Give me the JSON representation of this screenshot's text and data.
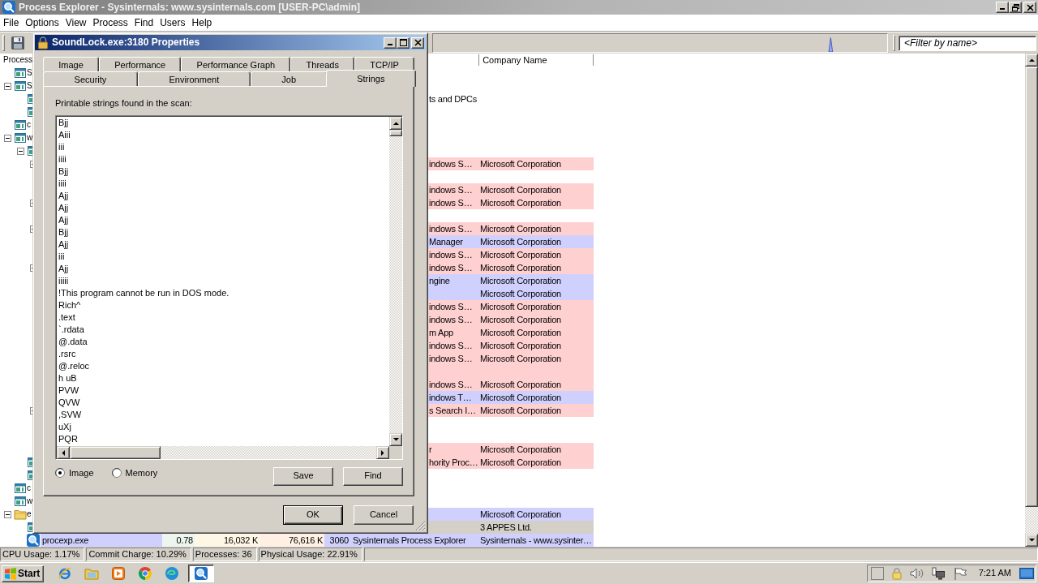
{
  "window": {
    "title": "Process Explorer - Sysinternals: www.sysinternals.com [USER-PC\\admin]"
  },
  "menu": [
    "File",
    "Options",
    "View",
    "Process",
    "Find",
    "Users",
    "Help"
  ],
  "toolbar": {
    "filter": {
      "placeholder": "<Filter by name>"
    }
  },
  "process_list": {
    "columns": [
      "Process",
      "Company Name"
    ],
    "tree": [
      {
        "kind": "window",
        "label": "S",
        "selected": false
      },
      {
        "kind": "window",
        "label": "S",
        "expanded": true,
        "selected": false,
        "children": [
          {
            "kind": "window",
            "description": "ts and DPCs",
            "selected": false
          },
          {
            "kind": "window",
            "selected": false
          }
        ]
      },
      {
        "kind": "window",
        "label": "c",
        "selected": false
      },
      {
        "kind": "window",
        "label": "w",
        "expanded": true,
        "selected": false,
        "children": [
          {
            "kind": "window",
            "expanded": true,
            "selected": false,
            "children": [
              {
                "description": "indows S…",
                "company": "Microsoft Corporation",
                "color": "#ffd0d0",
                "selected": false,
                "children": [
                  {
                    "selected": false
                  },
                  {
                    "description": "indows S…",
                    "company": "Microsoft Corporation",
                    "color": "#ffd0d0",
                    "selected": false
                  }
                ]
              },
              {
                "description": "indows S…",
                "company": "Microsoft Corporation",
                "color": "#ffd0d0",
                "selected": false,
                "children": [
                  {
                    "selected": false
                  }
                ]
              },
              {
                "description": "indows S…",
                "company": "Microsoft Corporation",
                "color": "#ffd0d0",
                "selected": false,
                "children": [
                  {
                    "description": "Manager",
                    "company": "Microsoft Corporation",
                    "color": "#d0d0ff",
                    "selected": false
                  },
                  {
                    "description": "indows S…",
                    "company": "Microsoft Corporation",
                    "color": "#ffd0d0",
                    "selected": false
                  }
                ]
              },
              {
                "description": "indows S…",
                "company": "Microsoft Corporation",
                "color": "#ffd0d0",
                "selected": false,
                "children": [
                  {
                    "description": "ngine",
                    "company": "Microsoft Corporation",
                    "color": "#d0d0ff",
                    "selected": false
                  },
                  {
                    "company": "Microsoft Corporation",
                    "color": "#d0d0ff",
                    "selected": false
                  },
                  {
                    "description": "indows S…",
                    "company": "Microsoft Corporation",
                    "color": "#ffd0d0",
                    "selected": false
                  },
                  {
                    "description": "indows S…",
                    "company": "Microsoft Corporation",
                    "color": "#ffd0d0",
                    "selected": false
                  },
                  {
                    "description": "m App",
                    "company": "Microsoft Corporation",
                    "color": "#ffd0d0",
                    "selected": false
                  },
                  {
                    "description": "indows S…",
                    "company": "Microsoft Corporation",
                    "color": "#ffd0d0",
                    "selected": false
                  },
                  {
                    "description": "indows S…",
                    "company": "Microsoft Corporation",
                    "color": "#ffd0d0",
                    "selected": false
                  },
                  {
                    "color": "#ffd0d0",
                    "selected": false
                  },
                  {
                    "description": "indows S…",
                    "company": "Microsoft Corporation",
                    "color": "#ffd0d0",
                    "selected": false
                  },
                  {
                    "description": "indows T…",
                    "company": "Microsoft Corporation",
                    "color": "#d0d0ff",
                    "selected": false
                  }
                ]
              },
              {
                "description": "s Search I…",
                "company": "Microsoft Corporation",
                "color": "#ffd0d0",
                "selected": false,
                "children": [
                  {
                    "selected": false
                  },
                  {
                    "selected": false
                  },
                  {
                    "description": "r",
                    "company": "Microsoft Corporation",
                    "color": "#ffd0d0",
                    "selected": false
                  }
                ]
              }
            ]
          },
          {
            "kind": "window",
            "description": "hority Proc…",
            "company": "Microsoft Corporation",
            "color": "#ffd0d0",
            "selected": false
          },
          {
            "kind": "window",
            "selected": false
          }
        ]
      },
      {
        "kind": "window",
        "label": "c",
        "selected": false
      },
      {
        "kind": "window",
        "label": "w",
        "selected": false
      },
      {
        "kind": "folder",
        "label": "e",
        "expanded": true,
        "company": "Microsoft Corporation",
        "color": "#d0d0ff",
        "selected": false,
        "children": [
          {
            "kind": "window",
            "company": "3 APPES Ltd.",
            "selected": true
          },
          {
            "kind": "full",
            "label": "procexp.exe",
            "cpu": "0.78",
            "private_bytes": "16,032 K",
            "working_set": "76,616 K",
            "pid": "3060",
            "description": "Sysinternals Process Explorer",
            "company": "Sysinternals - www.sysinter…",
            "color": "#d0d0ff",
            "selected": false
          }
        ]
      }
    ]
  },
  "status_bar": [
    "CPU Usage: 1.17%",
    "Commit Charge: 10.29%",
    "Processes: 36",
    "Physical Usage: 22.91%"
  ],
  "taskbar": {
    "start": "Start",
    "apps": [
      {
        "selected": false
      },
      {
        "selected": false
      },
      {
        "selected": false
      },
      {
        "selected": false
      },
      {
        "selected": false
      },
      {
        "selected": true
      }
    ],
    "clock": "7:21 AM"
  },
  "dialog": {
    "title": "SoundLock.exe:3180 Properties",
    "tabs": [
      [
        {
          "label": "Image",
          "selected": false
        },
        {
          "label": "Performance",
          "selected": false
        },
        {
          "label": "Performance Graph",
          "selected": false
        },
        {
          "label": "Threads",
          "selected": false
        },
        {
          "label": "TCP/IP",
          "selected": false
        }
      ],
      [
        {
          "label": "Security",
          "selected": false
        },
        {
          "label": "Environment",
          "selected": false
        },
        {
          "label": "Job",
          "selected": false
        },
        {
          "label": "Strings",
          "selected": true
        }
      ]
    ],
    "strings_panel": {
      "caption": "Printable strings found in the scan:",
      "strings": [
        "Bjj",
        "Aiii",
        "iii",
        "iiii",
        "Bjj",
        "iiii",
        "Ajj",
        "Ajj",
        "Ajj",
        "Bjj",
        "Ajj",
        "iii",
        "Ajj",
        "iiiii",
        "!This program cannot be run in DOS mode.",
        "Rich^",
        ".text",
        "`.rdata",
        "@.data",
        ".rsrc",
        "@.reloc",
        "h uB",
        "PVW",
        "QVW",
        ",SVW",
        "uXj",
        "PQR"
      ],
      "sources": [
        {
          "label": "Image",
          "selected": true
        },
        {
          "label": "Memory",
          "selected": false
        }
      ],
      "buttons": [
        "Save",
        "Find"
      ]
    },
    "buttons": [
      {
        "label": "OK",
        "default": true
      },
      {
        "label": "Cancel",
        "default": false
      }
    ]
  }
}
